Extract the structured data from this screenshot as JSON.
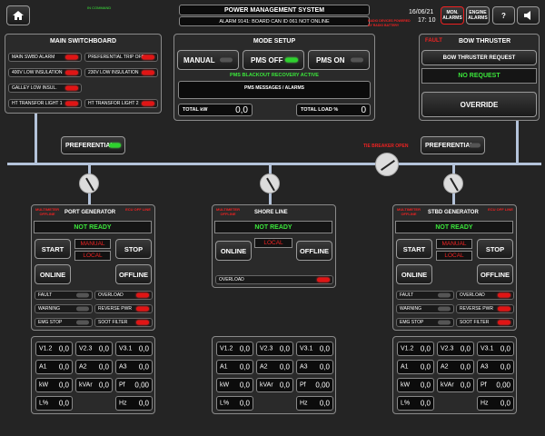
{
  "header": {
    "command_label": "IN COMMAND",
    "title": "POWER MANAGEMENT SYSTEM",
    "alarm": "ALARM 9141: BOARD CAN ID 061 NOT ONLINE",
    "radio_note": "RADIO DEVICES POWERED BY RADIO BATTERY",
    "date": "16/06/21",
    "time": "17: 10",
    "mon_alarms": "MON. ALARMS",
    "engine_alarms": "ENGINE ALARMS",
    "help": "?"
  },
  "main_switchboard": {
    "title": "MAIN SWITCHBOARD",
    "items": [
      {
        "label": "MAIN SWBD ALARM",
        "state": "red"
      },
      {
        "label": "PREFERENTIAL TRIP OFF",
        "state": "red"
      },
      {
        "label": "400V LOW INSULATION",
        "state": "red"
      },
      {
        "label": "230V LOW INSULATION",
        "state": "red"
      },
      {
        "label": "GALLEY LOW INSUL.",
        "state": "red"
      },
      {
        "label": "HT TRANSFOR LIGHT 1",
        "state": "red"
      },
      {
        "label": "HT TRANSFOR LIGHT 2",
        "state": "red"
      }
    ]
  },
  "mode_setup": {
    "title": "MODE SETUP",
    "manual": "MANUAL",
    "pms_off": "PMS OFF",
    "pms_on": "PMS ON",
    "blackout": "PMS BLACKOUT RECOVERY ACTIVE",
    "messages": "PMS MESSAGES / ALARMS",
    "total_kw_label": "TOTAL kW",
    "total_kw": "0,0",
    "total_load_label": "TOTAL LOAD %",
    "total_load": "0"
  },
  "bow_thruster": {
    "fault": "FAULT",
    "title": "BOW THRUSTER",
    "request": "BOW THRUSTER REQUEST",
    "status": "NO REQUEST",
    "override": "OVERRIDE"
  },
  "bus": {
    "preferential_left": "PREFERENTIAL",
    "preferential_right": "PREFERENTIAL",
    "tie_breaker": "TIE BREAKER OPEN"
  },
  "port": {
    "multimeter": "MULTIMETER OFFLINE",
    "title": "PORT GENERATOR",
    "ecu": "ECU OFF LINE",
    "status": "NOT READY",
    "start": "START",
    "stop": "STOP",
    "manual": "MANUAL",
    "local": "LOCAL",
    "online": "ONLINE",
    "offline": "OFFLINE",
    "alarms": [
      "FAULT",
      "OVERLOAD",
      "WARNING",
      "REVERSE PWR",
      "EMG STOP",
      "SOOT FILTER"
    ]
  },
  "shore": {
    "multimeter": "MULTIMETER OFFLINE",
    "title": "SHORE LINE",
    "status": "NOT READY",
    "local": "LOCAL",
    "online": "ONLINE",
    "offline": "OFFLINE",
    "overload": "OVERLOAD"
  },
  "stbd": {
    "multimeter": "MULTIMETER OFFLINE",
    "title": "STBD GENERATOR",
    "ecu": "ECU OFF LINE",
    "status": "NOT READY",
    "start": "START",
    "stop": "STOP",
    "manual": "MANUAL",
    "local": "LOCAL",
    "online": "ONLINE",
    "offline": "OFFLINE",
    "alarms": [
      "FAULT",
      "OVERLOAD",
      "WARNING",
      "REVERSE PWR",
      "EMG STOP",
      "SOOT FILTER"
    ]
  },
  "meters": {
    "labels": [
      "V1.2",
      "V2.3",
      "V3.1",
      "A1",
      "A2",
      "A3",
      "kW",
      "kVAr",
      "Pf",
      "L%",
      "Hz"
    ],
    "port": [
      "0,0",
      "0,0",
      "0,0",
      "0,0",
      "0,0",
      "0,0",
      "0,0",
      "0,0",
      "0,00",
      "0,0",
      "0,0"
    ],
    "shore": [
      "0,0",
      "0,0",
      "0,0",
      "0,0",
      "0,0",
      "0,0",
      "0,0",
      "0,0",
      "0,00",
      "0,0",
      "0,0"
    ],
    "stbd": [
      "0,0",
      "0,0",
      "0,0",
      "0,0",
      "0,0",
      "0,0",
      "0,0",
      "0,0",
      "0,00",
      "0,0",
      "0,0"
    ]
  }
}
